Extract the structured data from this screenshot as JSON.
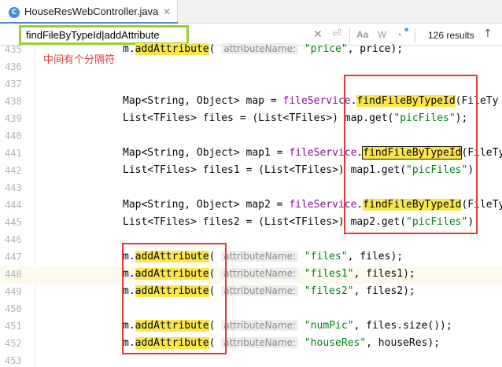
{
  "tab": {
    "icon_letter": "C",
    "title": "HouseResWebController.java"
  },
  "search": {
    "value": "findFileByTypeId|addAttribute",
    "results": "126 results",
    "clear_icon": "close-icon",
    "case_label": "Aa",
    "word_label": "W",
    "regex_label": ".*",
    "accent_color": "#9bd02c"
  },
  "annotation": {
    "text": "中间有个分隔符",
    "color": "#e53935"
  },
  "editor": {
    "current_line": "448",
    "lines": [
      {
        "num": "435"
      },
      {
        "num": "436"
      },
      {
        "num": "437"
      },
      {
        "num": "438"
      },
      {
        "num": "439"
      },
      {
        "num": "440"
      },
      {
        "num": "441"
      },
      {
        "num": "442"
      },
      {
        "num": "443"
      },
      {
        "num": "444"
      },
      {
        "num": "445"
      },
      {
        "num": "446"
      },
      {
        "num": "447"
      },
      {
        "num": "448"
      },
      {
        "num": "449"
      },
      {
        "num": "450"
      },
      {
        "num": "451"
      },
      {
        "num": "452"
      },
      {
        "num": "453"
      }
    ],
    "tokens": {
      "m_dot": "m.",
      "add_attribute": "addAttribute",
      "find_file": "findFileByTypeId",
      "paren_open": "(",
      "hint": "attributeName:",
      "map_decl": "Map<String, Object> map = ",
      "map1_decl": "Map<String, Object> map1 = ",
      "map2_decl": "Map<String, Object> map2 = ",
      "file_service": "fileService",
      "dot": ".",
      "after_call": "(FileTy",
      "after_call1": "(FileTy",
      "after_call2": "(FileTy",
      "list_files": "List<TFiles> files = (List<TFiles>) map.get(",
      "list_files1": "List<TFiles> files1 = (List<TFiles>) map1.get(",
      "list_files2": "List<TFiles> files2 = (List<TFiles>) map2.get(",
      "pic_files": "\"picFiles\"",
      "close_semi": ");",
      "price_str": "\"price\"",
      "price_tail": ", price);",
      "files_str": "\"files\"",
      "files_tail": ", files);",
      "files1_str": "\"files1\"",
      "files1_tail": ", files1);",
      "files2_str": "\"files2\"",
      "files2_tail": ", files2);",
      "numpic_str": "\"numPic\"",
      "numpic_tail": ", files.size());",
      "houseres_str": "\"houseRes\"",
      "houseres_tail": ", houseRes);"
    }
  }
}
